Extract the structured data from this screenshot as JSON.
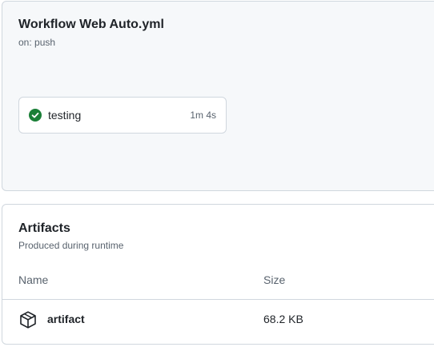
{
  "workflow": {
    "title": "Workflow Web Auto.yml",
    "trigger": "on: push",
    "jobs": [
      {
        "name": "testing",
        "duration": "1m 4s",
        "status": "success",
        "status_color": "#1a7f37",
        "icon": "check-circle-icon"
      }
    ]
  },
  "artifacts": {
    "title": "Artifacts",
    "subtitle": "Produced during runtime",
    "columns": {
      "name": "Name",
      "size": "Size"
    },
    "rows": [
      {
        "name": "artifact",
        "size": "68.2 KB",
        "icon": "package-icon"
      }
    ]
  },
  "colors": {
    "border": "#d0d7de",
    "panel_bg": "#f6f8fa",
    "text": "#1f2328",
    "muted": "#59636e",
    "success": "#1a7f37"
  }
}
